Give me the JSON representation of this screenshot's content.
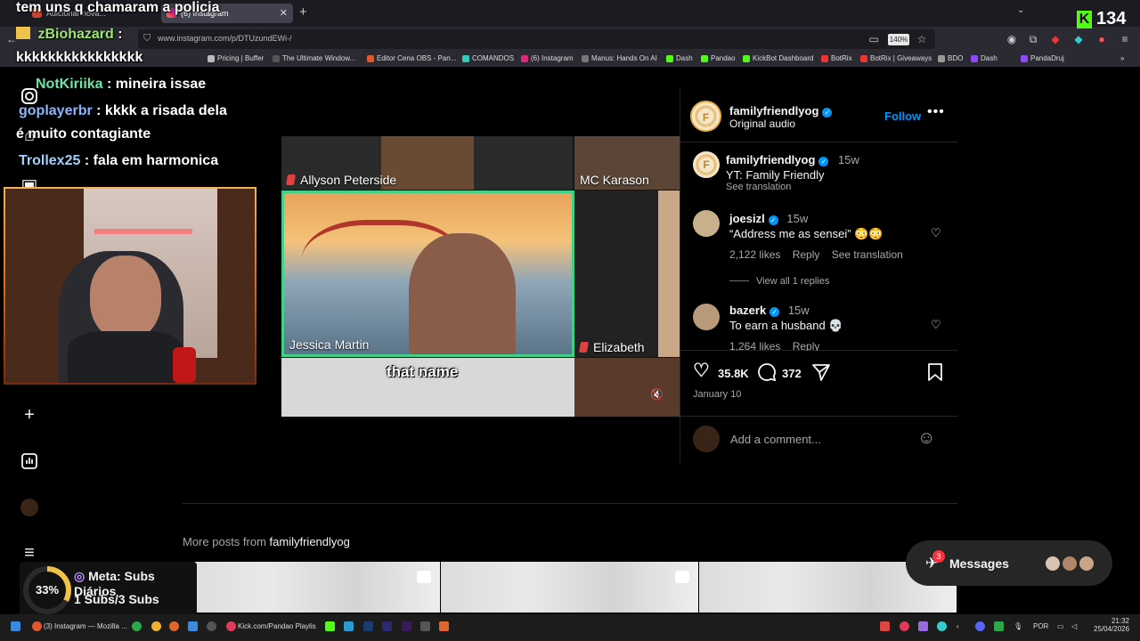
{
  "browser": {
    "tabs": [
      {
        "title": "Adicionar nova..."
      },
      {
        "title": "(6) Instagram"
      }
    ],
    "url": "www.instagram.com/p/DTUzundEWi-/",
    "zoom": "140%",
    "bookmarks": [
      "Pricing | Buffer",
      "The Ultimate Window...",
      "Editor Cena OBS - Pan...",
      "COMANDOS",
      "(6) Instagram",
      "Manus: Hands On AI",
      "Dash",
      "Pandao",
      "KickBot Dashboard",
      "BotRix",
      "BotRix | Giveaways",
      "BDO",
      "Dash",
      "PandaDruj"
    ]
  },
  "stream": {
    "chat": [
      {
        "user": "",
        "message": "tem uns q chamaram a policia"
      },
      {
        "user": "zBiohazard",
        "message": ":"
      },
      {
        "user": "",
        "message": "kkkkkkkkkkkkkkkk"
      },
      {
        "user": "NotKiriika",
        "message": ": mineira issae"
      },
      {
        "user": "goplayerbr",
        "message": ": kkkk a risada dela"
      },
      {
        "user": "",
        "message": "é muito contagiante"
      },
      {
        "user": "Trollex25",
        "message": ": fala em harmonica"
      }
    ],
    "user_colors": {
      "zBiohazard": "#9be870",
      "NotKiriika": "#6ee6a8",
      "goplayerbr": "#8ab6ff",
      "Trollex25": "#9fd0ff"
    },
    "viewer_count": "134",
    "goal": {
      "percent": "33%",
      "progress": 0.33,
      "title": "Meta: Subs Diários",
      "value": "1 Subs/3 Subs"
    }
  },
  "video": {
    "participants": [
      "Allyson Peterside",
      "MC Karason",
      "Jessica Martin",
      "Elizabeth"
    ],
    "caption": "that name"
  },
  "post": {
    "author": "familyfriendlyog",
    "audio": "Original audio",
    "follow_label": "Follow",
    "caption": {
      "user": "familyfriendlyog",
      "time": "15w",
      "text": "YT: Family Friendly",
      "translate": "See translation"
    },
    "comments": [
      {
        "user": "joesizl",
        "time": "15w",
        "text": "“Address me as sensei” 😳😳",
        "likes": "2,122 likes",
        "reply": "Reply",
        "translate": "See translation",
        "view_replies": "View all 1 replies"
      },
      {
        "user": "bazerk",
        "time": "15w",
        "text": "To earn a husband 💀",
        "likes": "1,264 likes",
        "reply": "Reply"
      }
    ],
    "like_count": "35.8K",
    "comment_count": "372",
    "date": "January 10",
    "add_comment_placeholder": "Add a comment...",
    "more_posts_prefix": "More posts from",
    "more_posts_user": "familyfriendlyog"
  },
  "messages": {
    "label": "Messages",
    "badge": "3"
  },
  "taskbar": {
    "items": [
      "(3) Instagram — Mozilla ...",
      "Kick.com/Pandao Playlis"
    ],
    "lang": "POR",
    "time": "21:32",
    "date": "25/04/2026"
  },
  "colors": {
    "accent": "#0095f6",
    "kick": "#53fc18",
    "badge": "#ff3040"
  }
}
